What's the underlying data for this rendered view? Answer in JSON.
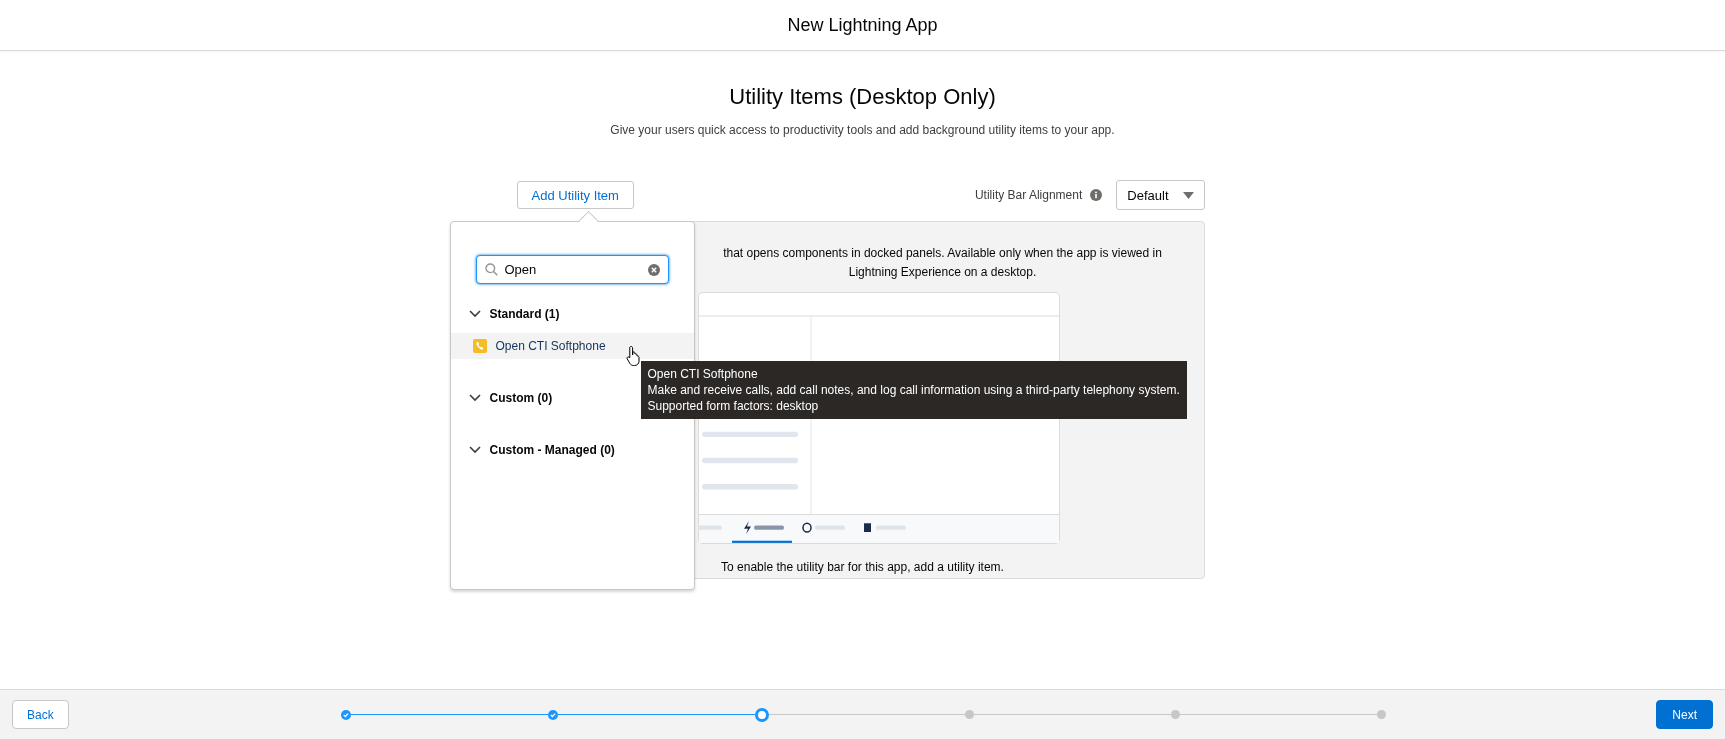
{
  "header": {
    "title": "New Lightning App"
  },
  "page": {
    "heading": "Utility Items (Desktop Only)",
    "subtitle": "Give your users quick access to productivity tools and add background utility items to your app."
  },
  "toolbar": {
    "add_button": "Add Utility Item",
    "alignment_label": "Utility Bar Alignment",
    "alignment_select": {
      "value": "Default"
    }
  },
  "panel": {
    "description": "that opens components in docked panels. Available only when the app is viewed in Lightning Experience on a desktop.",
    "empty_message": "To enable the utility bar for this app, add a utility item."
  },
  "popover": {
    "search": {
      "value": "Open"
    },
    "sections": [
      {
        "label": "Standard (1)",
        "expanded": true,
        "items": [
          {
            "label": "Open CTI Softphone",
            "highlighted": true
          }
        ]
      },
      {
        "label": "Custom (0)",
        "expanded": true
      },
      {
        "label": "Custom - Managed (0)",
        "expanded": true
      }
    ]
  },
  "tooltip": {
    "title": "Open CTI Softphone",
    "description": "Make and receive calls, add call notes, and log call information using a third-party telephony system.",
    "form_factors": "Supported form factors: desktop"
  },
  "footer": {
    "back": "Back",
    "next": "Next",
    "steps": [
      {
        "completed": true,
        "selected": false
      },
      {
        "completed": true,
        "selected": false
      },
      {
        "completed": false,
        "selected": true
      },
      {
        "completed": false,
        "selected": false
      },
      {
        "completed": false,
        "selected": false
      },
      {
        "completed": false,
        "selected": false
      }
    ]
  }
}
